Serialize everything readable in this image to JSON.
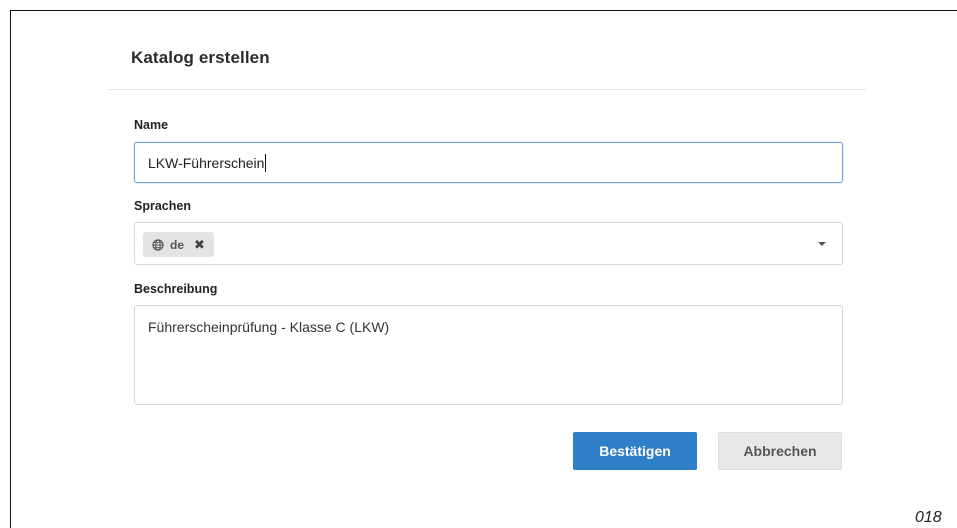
{
  "dialog": {
    "title": "Katalog erstellen"
  },
  "fields": {
    "name_label": "Name",
    "name_value": "LKW-Führerschein",
    "languages_label": "Sprachen",
    "languages_selected": [
      {
        "code": "de",
        "icon": "globe-icon",
        "remove_icon": "close-icon"
      }
    ],
    "description_label": "Beschreibung",
    "description_value": "Führerscheinprüfung - Klasse C (LKW)"
  },
  "buttons": {
    "confirm_label": "Bestätigen",
    "cancel_label": "Abbrechen"
  },
  "page_id": "018",
  "colors": {
    "primary": "#2f7fc8",
    "focus_border": "#6fa5d8",
    "cancel_bg": "#e8e8e8"
  }
}
